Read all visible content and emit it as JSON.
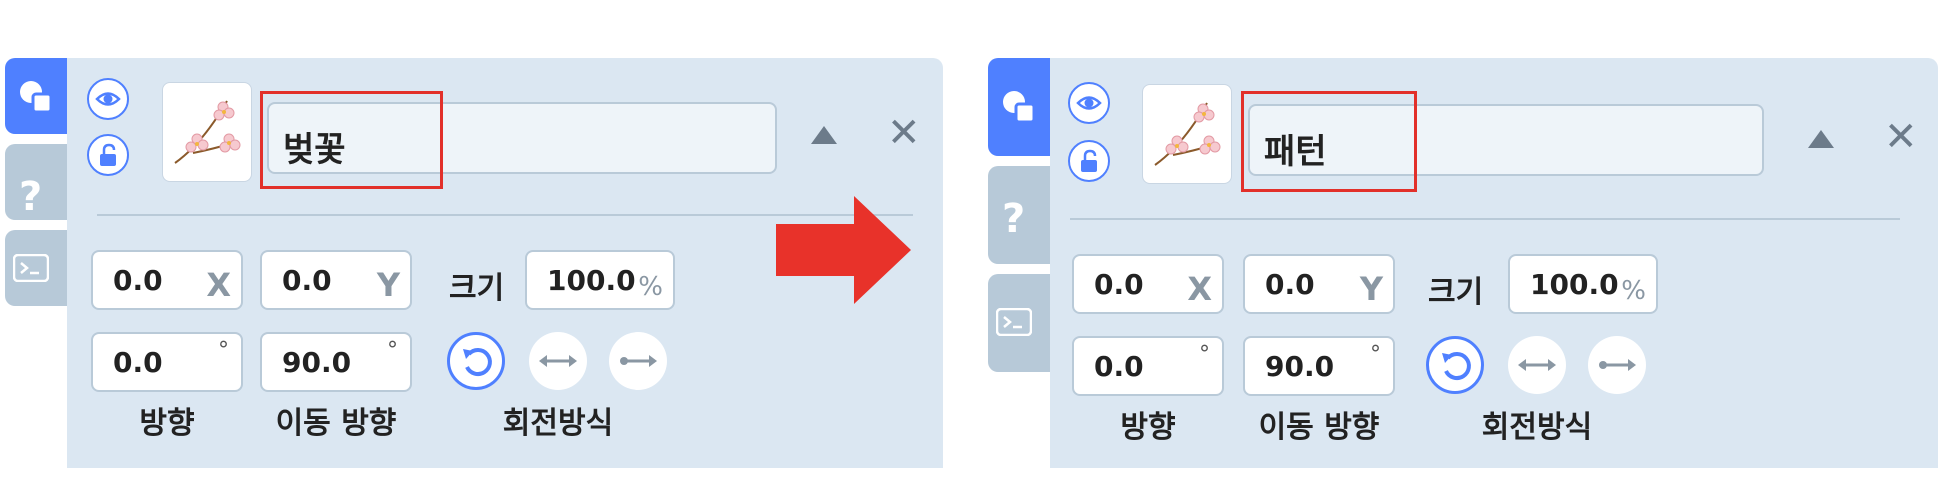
{
  "before": {
    "object_name": "벚꽃",
    "x_value": "0.0",
    "x_unit": "X",
    "y_value": "0.0",
    "y_unit": "Y",
    "size_label": "크기",
    "size_value": "100.0",
    "size_unit": "%",
    "direction_value": "0.0",
    "move_direction_value": "90.0",
    "degree_symbol": "°",
    "direction_label": "방향",
    "move_direction_label": "이동 방향",
    "rotation_label": "회전방식"
  },
  "after": {
    "object_name": "패턴",
    "x_value": "0.0",
    "x_unit": "X",
    "y_value": "0.0",
    "y_unit": "Y",
    "size_label": "크기",
    "size_value": "100.0",
    "size_unit": "%",
    "direction_value": "0.0",
    "move_direction_value": "90.0",
    "degree_symbol": "°",
    "direction_label": "방향",
    "move_direction_label": "이동 방향",
    "rotation_label": "회전방식"
  },
  "tabs": {
    "help_glyph": "?"
  },
  "colors": {
    "accent": "#4f80ff",
    "panel_bg": "#dbe7f2",
    "highlight": "#e2302a",
    "arrow": "#e8322a"
  },
  "icons": [
    "shape-tab-icon",
    "help-tab-icon",
    "console-tab-icon",
    "eye-icon",
    "unlock-icon",
    "cherry-blossom-thumbnail",
    "collapse-triangle-icon",
    "close-icon",
    "rotate-free-icon",
    "rotate-horizontal-icon",
    "rotate-none-icon",
    "right-arrow"
  ]
}
